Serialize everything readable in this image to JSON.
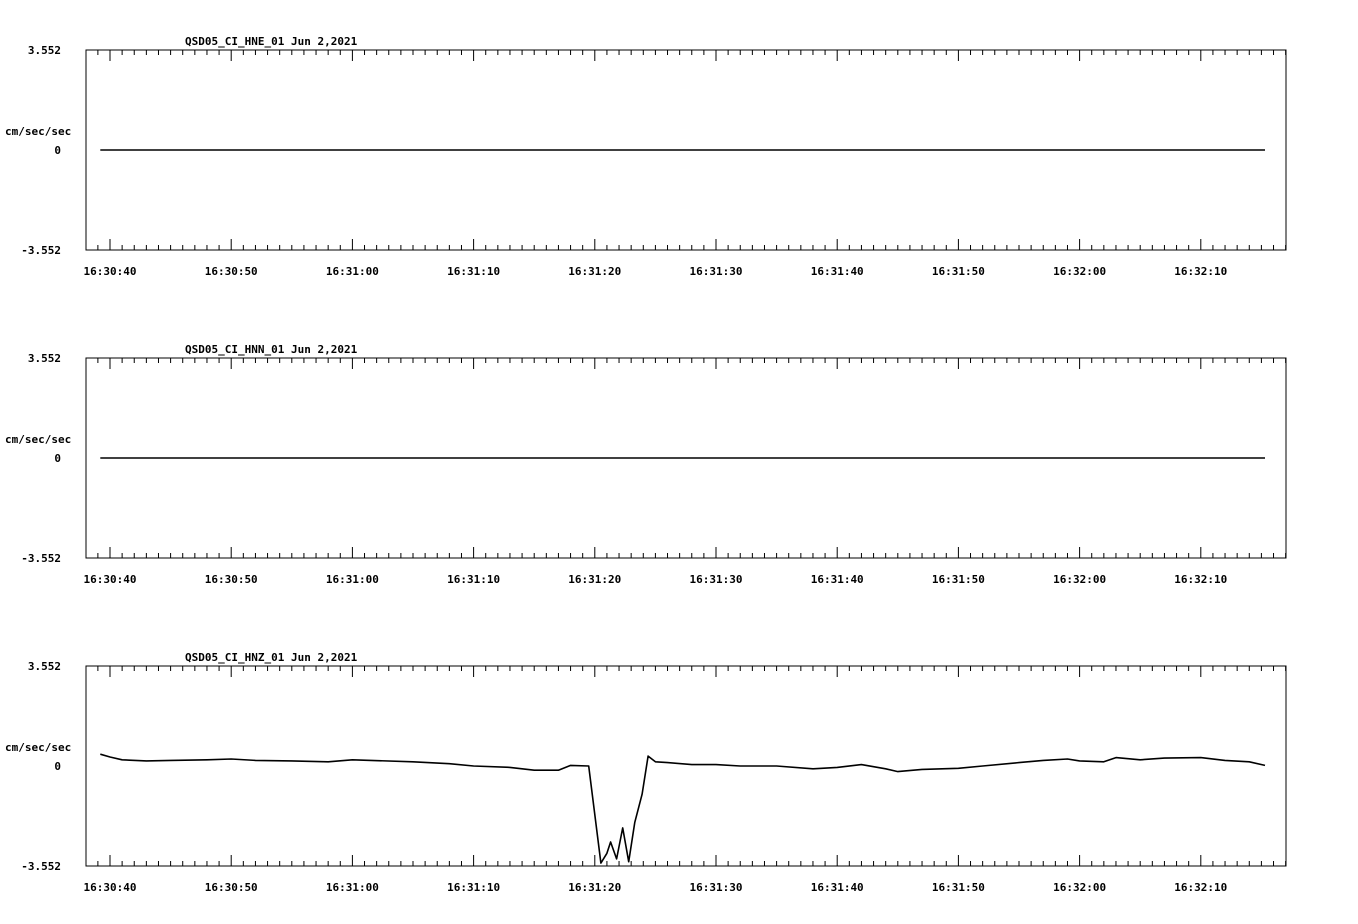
{
  "chart_data": [
    {
      "type": "line",
      "title": "QSD05_CI_HNE_01  Jun 2,2021",
      "ylabel": "cm/sec/sec",
      "yticks": [
        "3.552",
        "0",
        "-3.552"
      ],
      "ylim": [
        -3.552,
        3.552
      ],
      "xticks": [
        "16:30:40",
        "16:30:50",
        "16:31:00",
        "16:31:10",
        "16:31:20",
        "16:31:30",
        "16:31:40",
        "16:31:50",
        "16:32:00",
        "16:32:10"
      ],
      "xlim_seconds_after_16_30_40": [
        -2,
        97
      ],
      "series": [
        {
          "x": [
            -0.8,
            95.3
          ],
          "y": [
            0,
            0
          ]
        }
      ]
    },
    {
      "type": "line",
      "title": "QSD05_CI_HNN_01  Jun 2,2021",
      "ylabel": "cm/sec/sec",
      "yticks": [
        "3.552",
        "0",
        "-3.552"
      ],
      "ylim": [
        -3.552,
        3.552
      ],
      "xticks": [
        "16:30:40",
        "16:30:50",
        "16:31:00",
        "16:31:10",
        "16:31:20",
        "16:31:30",
        "16:31:40",
        "16:31:50",
        "16:32:00",
        "16:32:10"
      ],
      "xlim_seconds_after_16_30_40": [
        -2,
        97
      ],
      "series": [
        {
          "x": [
            -0.8,
            95.3
          ],
          "y": [
            0,
            0
          ]
        }
      ]
    },
    {
      "type": "line",
      "title": "QSD05_CI_HNZ_01  Jun 2,2021",
      "ylabel": "cm/sec/sec",
      "yticks": [
        "3.552",
        "0",
        "-3.552"
      ],
      "ylim": [
        -3.552,
        3.552
      ],
      "xticks": [
        "16:30:40",
        "16:30:50",
        "16:31:00",
        "16:31:10",
        "16:31:20",
        "16:31:30",
        "16:31:40",
        "16:31:50",
        "16:32:00",
        "16:32:10"
      ],
      "xlim_seconds_after_16_30_40": [
        -2,
        97
      ],
      "series": [
        {
          "x": [
            -0.8,
            0,
            1,
            3,
            5,
            8,
            10,
            12,
            15,
            18,
            20,
            25,
            28,
            30,
            33,
            35,
            37,
            38,
            39.5,
            40.5,
            41,
            41.3,
            41.8,
            42.3,
            42.8,
            43.3,
            43.9,
            44.4,
            45,
            46,
            48,
            50,
            52,
            55,
            58,
            60,
            62,
            64,
            65,
            67,
            70,
            72,
            75,
            77,
            79,
            80,
            82,
            83,
            85,
            87,
            90,
            92,
            94,
            95.3
          ],
          "y": [
            0.42,
            0.32,
            0.22,
            0.18,
            0.2,
            0.22,
            0.25,
            0.2,
            0.18,
            0.15,
            0.22,
            0.15,
            0.08,
            0.0,
            -0.05,
            -0.15,
            -0.15,
            0.02,
            0.0,
            -3.45,
            -3.1,
            -2.7,
            -3.3,
            -2.2,
            -3.4,
            -2.0,
            -1.0,
            0.35,
            0.15,
            0.12,
            0.05,
            0.05,
            0.0,
            0.0,
            -0.1,
            -0.05,
            0.05,
            -0.1,
            -0.2,
            -0.12,
            -0.08,
            0.0,
            0.12,
            0.2,
            0.25,
            0.18,
            0.15,
            0.3,
            0.22,
            0.28,
            0.3,
            0.2,
            0.15,
            0.02
          ]
        }
      ]
    }
  ]
}
